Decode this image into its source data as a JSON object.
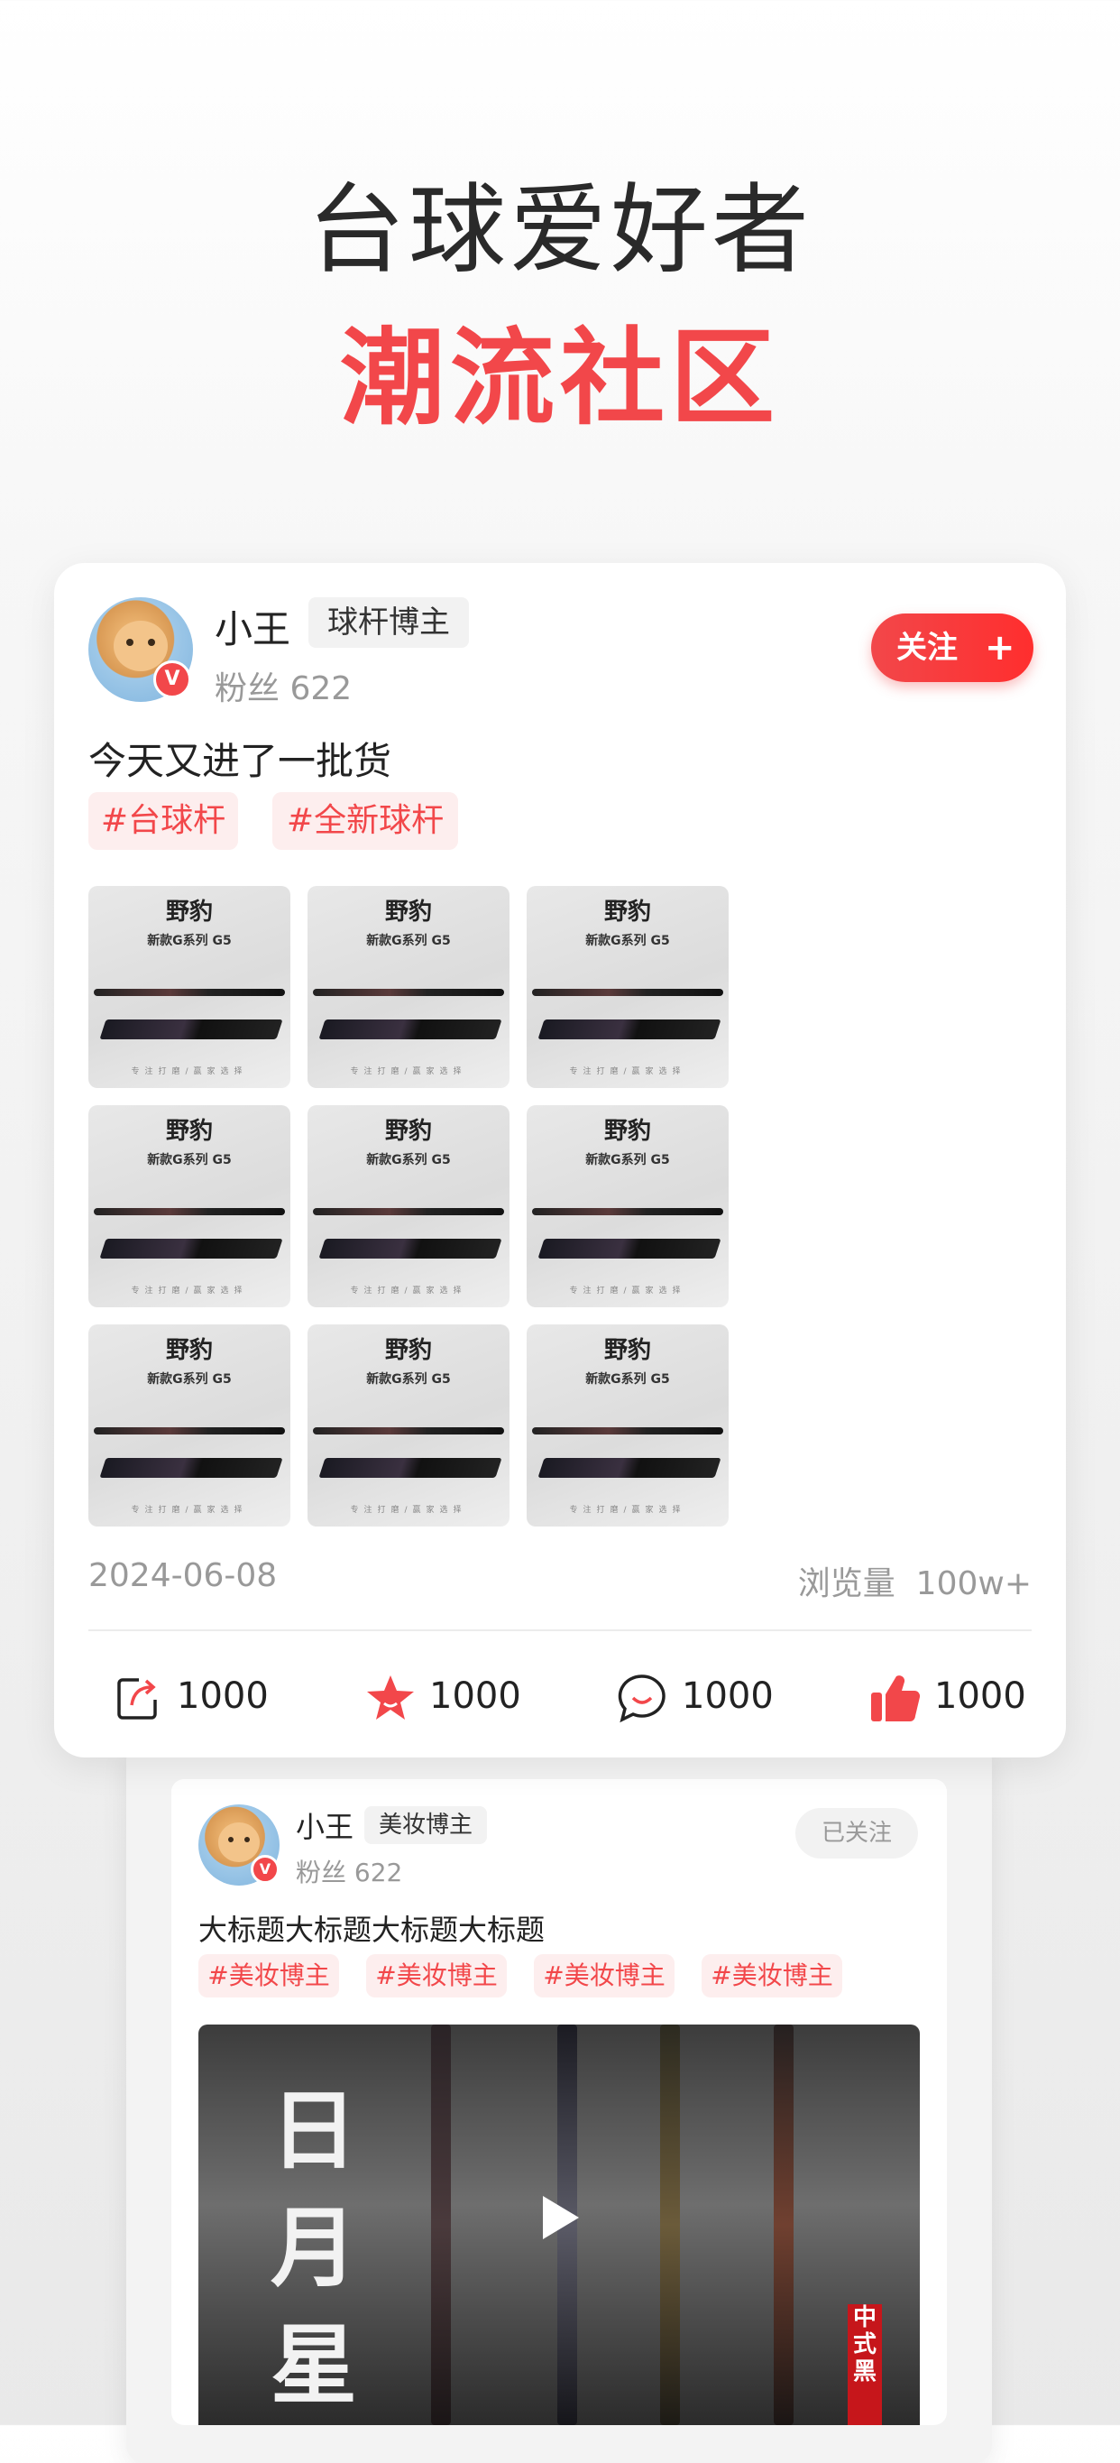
{
  "hero": {
    "line1": "台球爱好者",
    "line2": "潮流社区"
  },
  "post": {
    "author": "小王",
    "role_tag": "球杆博主",
    "fans_label": "粉丝 622",
    "follow_label": "关注",
    "follow_plus": "+",
    "verified": "V",
    "title": "今天又进了一批货",
    "hashtags": [
      "#台球杆",
      "#全新球杆"
    ],
    "image_brand": "野豹",
    "image_series": "新款G系列 G5",
    "image_slogan": "专注打磨/赢家选择",
    "image_count": 9,
    "date": "2024-06-08",
    "views": "浏览量  100w+",
    "actions": {
      "share": "1000",
      "favorite": "1000",
      "comment": "1000",
      "like": "1000"
    }
  },
  "post2": {
    "author": "小王",
    "role_tag": "美妆博主",
    "fans_label": "粉丝 622",
    "followed_label": "已关注",
    "verified": "V",
    "title": "大标题大标题大标题大标题",
    "hashtags": [
      "#美妆博主",
      "#美妆博主",
      "#美妆博主",
      "#美妆博主"
    ],
    "video_calligraphy": [
      "日",
      "月",
      "星"
    ],
    "video_seal": "中式黑"
  },
  "colors": {
    "accent": "#f2474a",
    "chip_bg": "#fdeeee"
  },
  "icons": [
    "share-icon",
    "star-icon",
    "comment-icon",
    "thumbs-up-icon",
    "play-icon",
    "verified-badge-icon"
  ]
}
